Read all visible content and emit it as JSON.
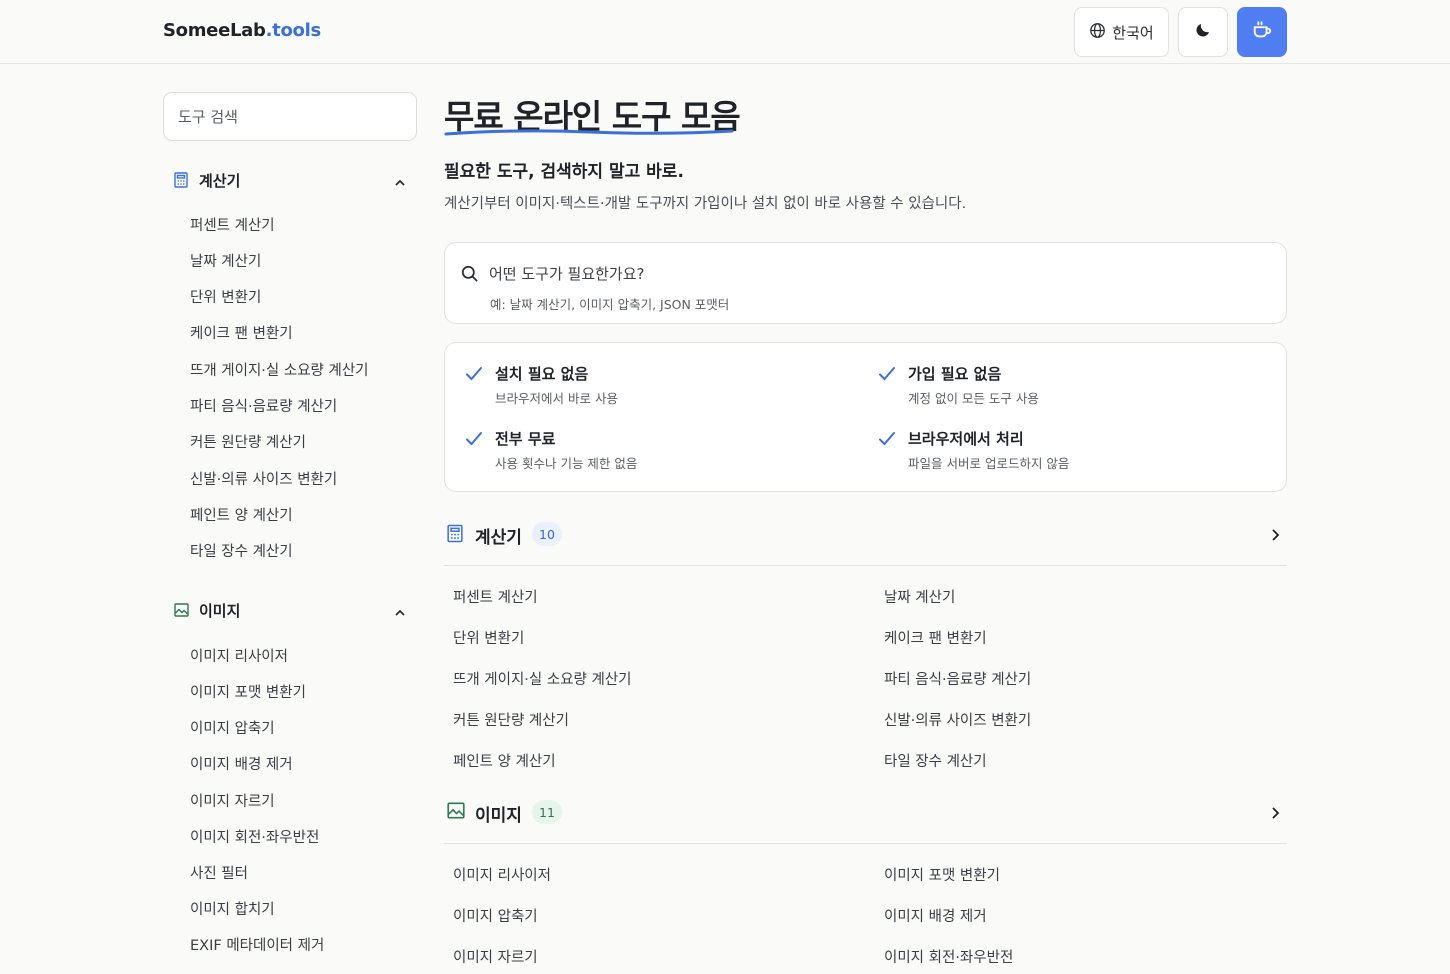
{
  "header": {
    "logo_main": "SomeeLab",
    "logo_suffix": ".tools",
    "language_label": "한국어"
  },
  "sidebar": {
    "search_placeholder": "도구 검색",
    "categories": [
      {
        "label": "계산기",
        "icon": "calculator-icon",
        "items": [
          "퍼센트 계산기",
          "날짜 계산기",
          "단위 변환기",
          "케이크 팬 변환기",
          "뜨개 게이지·실 소요량 계산기",
          "파티 음식·음료량 계산기",
          "커튼 원단량 계산기",
          "신발·의류 사이즈 변환기",
          "페인트 양 계산기",
          "타일 장수 계산기"
        ]
      },
      {
        "label": "이미지",
        "icon": "image-icon",
        "items": [
          "이미지 리사이저",
          "이미지 포맷 변환기",
          "이미지 압축기",
          "이미지 배경 제거",
          "이미지 자르기",
          "이미지 회전·좌우반전",
          "사진 필터",
          "이미지 합치기",
          "EXIF 메타데이터 제거"
        ]
      }
    ]
  },
  "main": {
    "title": "무료 온라인 도구 모음",
    "subtitle": "필요한 도구, 검색하지 말고 바로.",
    "description": "계산기부터 이미지·텍스트·개발 도구까지 가입이나 설치 없이 바로 사용할 수 있습니다.",
    "search": {
      "placeholder": "어떤 도구가 필요한가요?",
      "hint": "예: 날짜 계산기, 이미지 압축기, JSON 포맷터"
    },
    "features": [
      {
        "title": "설치 필요 없음",
        "sub": "브라우저에서 바로 사용"
      },
      {
        "title": "가입 필요 없음",
        "sub": "계정 없이 모든 도구 사용"
      },
      {
        "title": "전부 무료",
        "sub": "사용 횟수나 기능 제한 없음"
      },
      {
        "title": "브라우저에서 처리",
        "sub": "파일을 서버로 업로드하지 않음"
      }
    ],
    "sections": [
      {
        "label": "계산기",
        "count": "10",
        "tools": [
          "퍼센트 계산기",
          "날짜 계산기",
          "단위 변환기",
          "케이크 팬 변환기",
          "뜨개 게이지·실 소요량 계산기",
          "파티 음식·음료량 계산기",
          "커튼 원단량 계산기",
          "신발·의류 사이즈 변환기",
          "페인트 양 계산기",
          "타일 장수 계산기"
        ]
      },
      {
        "label": "이미지",
        "count": "11",
        "tools": [
          "이미지 리사이저",
          "이미지 포맷 변환기",
          "이미지 압축기",
          "이미지 배경 제거",
          "이미지 자르기",
          "이미지 회전·좌우반전"
        ]
      }
    ]
  },
  "colors": {
    "accent": "#4f7df2",
    "logo_accent": "#3b6fd9",
    "check": "#3b6fd9",
    "image_green": "#2c7a4e"
  }
}
